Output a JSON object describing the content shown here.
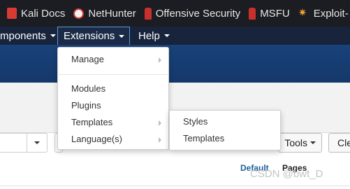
{
  "bookmarks": [
    {
      "label": "Kali Docs",
      "icon": "kali-docs-icon"
    },
    {
      "label": "NetHunter",
      "icon": "nethunter-icon"
    },
    {
      "label": "Offensive Security",
      "icon": "offensive-security-icon"
    },
    {
      "label": "MSFU",
      "icon": "msfu-icon"
    },
    {
      "label": "Exploit-",
      "icon": "exploit-db-icon"
    }
  ],
  "navbar": {
    "components_label": "mponents",
    "extensions_label": "Extensions",
    "help_label": "Help"
  },
  "extensions_menu": {
    "manage": "Manage",
    "modules": "Modules",
    "plugins": "Plugins",
    "templates": "Templates",
    "languages": "Language(s)"
  },
  "templates_submenu": {
    "styles": "Styles",
    "templates": "Templates"
  },
  "toolbar": {
    "tools_label": "Tools",
    "clear_label": "Cle"
  },
  "table": {
    "col_default": "Default",
    "col_pages": "Pages"
  },
  "watermark": "CSDN @bwt_D",
  "colors": {
    "bookmarks_bg": "#1b1d22",
    "navbar_bg": "#17243c",
    "header_band": "#18427a",
    "link_blue": "#1f5f99"
  }
}
